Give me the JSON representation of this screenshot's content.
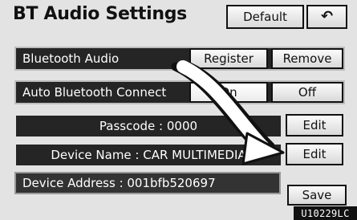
{
  "screen": {
    "title": "BT Audio Settings",
    "default_button": "Default",
    "back_icon": "back-arrow-icon",
    "back_glyph": "↶"
  },
  "rows": {
    "bluetooth_audio": {
      "label": "Bluetooth Audio",
      "register": "Register",
      "remove": "Remove"
    },
    "auto_connect": {
      "label": "Auto Bluetooth Connect",
      "on": "On",
      "off": "Off",
      "selected": "On"
    },
    "passcode": {
      "label": "Passcode : 0000",
      "edit": "Edit"
    },
    "device_name": {
      "label": "Device Name : CAR MULTIMEDIA",
      "edit": "Edit"
    },
    "device_address": {
      "label": "Device Address : 001bfb520697"
    },
    "save": "Save"
  },
  "figure_code": "U10229LC"
}
